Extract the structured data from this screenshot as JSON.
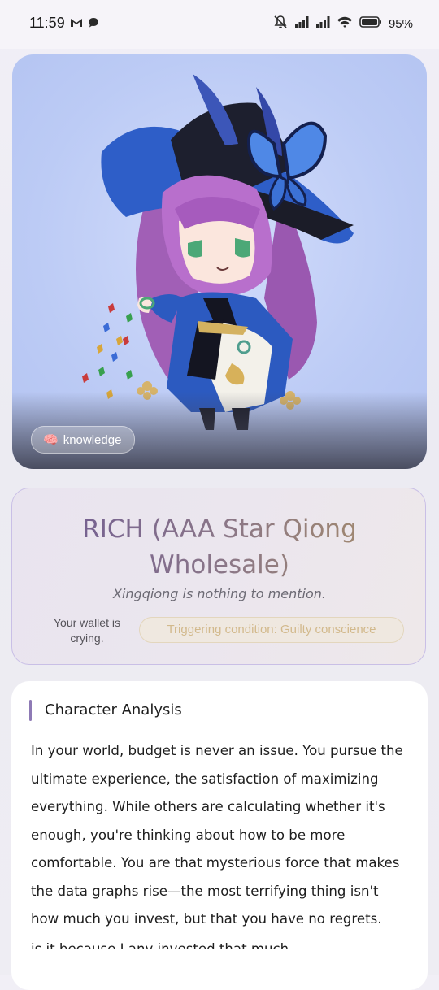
{
  "status_bar": {
    "time": "11:59",
    "battery_percent": "95%",
    "icons": [
      "gmail-icon",
      "chat-bubble-icon",
      "mute-icon",
      "signal-icon",
      "signal-icon",
      "wifi-icon",
      "battery-icon"
    ]
  },
  "hero": {
    "tag_emoji": "🧠",
    "tag_label": "knowledge"
  },
  "result": {
    "title": "RICH (AAA Star Qiong Wholesale)",
    "subtitle": "Xingqiong is nothing to mention.",
    "note": "Your wallet is crying.",
    "trigger": "Triggering condition: Guilty conscience",
    "colors": {
      "title_start": "#6f5a94",
      "title_end": "#a68d68",
      "border": "#c9bfe6",
      "trigger_text": "#d2b98c"
    }
  },
  "analysis": {
    "heading": "Character Analysis",
    "body": "In your world, budget is never an issue. You pursue the ultimate experience, the satisfaction of maximizing everything. While others are calculating whether it's enough, you're thinking about how to be more comfortable. You are that mysterious force that makes the data graphs rise—the most terrifying thing isn't how much you invest, but that you have no regrets.",
    "next_line": "is it because I any invested that much",
    "accent_color": "#8e7ab5"
  }
}
